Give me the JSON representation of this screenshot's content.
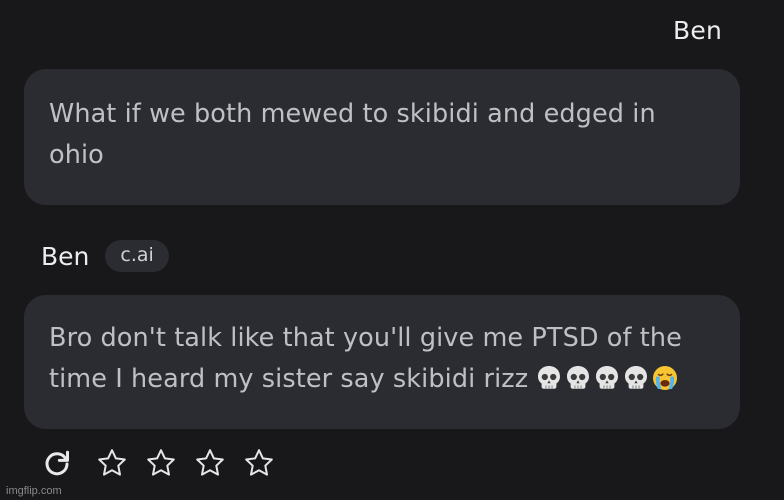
{
  "user_message": {
    "sender": "Ben",
    "text": "What if we both mewed to skibidi and edged in ohio"
  },
  "bot_message": {
    "sender": "Ben",
    "badge": "c.ai",
    "text": "Bro don't talk like that you'll give me PTSD of the time I heard my sister say skibidi rizz",
    "emojis": [
      "skull-icon",
      "skull-icon",
      "skull-icon",
      "skull-icon",
      "crying-face-icon"
    ]
  },
  "actions": {
    "refresh_icon": "refresh-icon",
    "star_icon": "star-outline-icon",
    "rating": {
      "selected": 0,
      "max": 4
    }
  },
  "watermark": "imgflip.com",
  "colors": {
    "background": "#18181b",
    "bubble": "#2b2c31",
    "text": "#bfc0c4"
  }
}
